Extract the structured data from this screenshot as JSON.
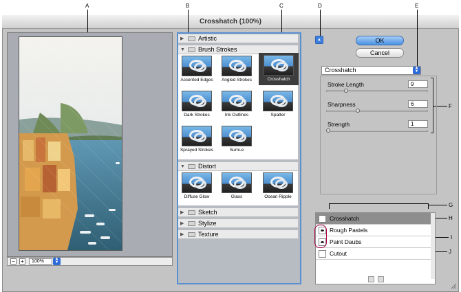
{
  "window": {
    "title": "Crosshatch (100%)"
  },
  "callouts": [
    "A",
    "B",
    "C",
    "D",
    "E",
    "F",
    "G",
    "H",
    "I",
    "J"
  ],
  "preview": {
    "zoom_out_label": "−",
    "zoom_in_label": "+",
    "zoom_value": "100%"
  },
  "gallery": {
    "categories": [
      {
        "label": "Artistic",
        "expanded": false
      },
      {
        "label": "Brush Strokes",
        "expanded": true,
        "filters": [
          "Accented Edges",
          "Angled Strokes",
          "Crosshatch",
          "Dark Strokes",
          "Ink Outlines",
          "Spatter",
          "Sprayed Strokes",
          "Sumi-e"
        ],
        "selected": "Crosshatch"
      },
      {
        "label": "Distort",
        "expanded": true,
        "filters": [
          "Diffuse Glow",
          "Glass",
          "Ocean Ripple"
        ]
      },
      {
        "label": "Sketch",
        "expanded": false
      },
      {
        "label": "Stylize",
        "expanded": false
      },
      {
        "label": "Texture",
        "expanded": false
      }
    ]
  },
  "buttons": {
    "ok": "OK",
    "cancel": "Cancel"
  },
  "filter_select": {
    "value": "Crosshatch"
  },
  "params": [
    {
      "label": "Stroke Length",
      "value": "9",
      "fraction": 0.18
    },
    {
      "label": "Sharpness",
      "value": "6",
      "fraction": 0.3
    },
    {
      "label": "Strength",
      "value": "1",
      "fraction": 0.0
    }
  ],
  "layers": [
    {
      "name": "Crosshatch",
      "visible": false,
      "active": true
    },
    {
      "name": "Rough Pastels",
      "visible": true,
      "active": false
    },
    {
      "name": "Paint Daubs",
      "visible": true,
      "active": false
    },
    {
      "name": "Cutout",
      "visible": false,
      "active": false
    }
  ],
  "colors": {
    "accent": "#3f80df",
    "selection_border": "#5a8fd0",
    "eye_highlight": "#b0004a"
  }
}
